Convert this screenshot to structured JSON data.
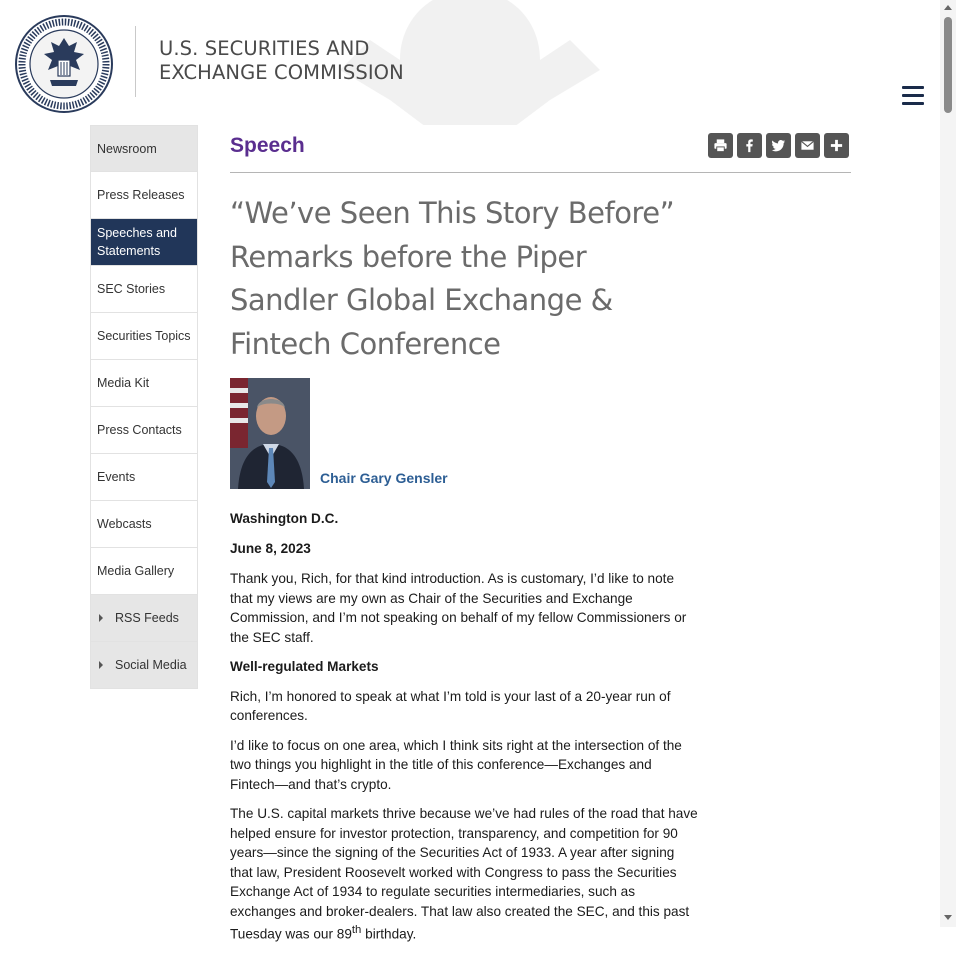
{
  "header": {
    "agency_line1": "U.S. SECURITIES AND",
    "agency_line2": "EXCHANGE COMMISSION",
    "seal_text": "U.S. SECURITIES AND EXCHANGE COMMISSION · MCMXXXIV",
    "menu_icon": "hamburger-icon"
  },
  "nav": {
    "items": [
      {
        "label": "Newsroom"
      },
      {
        "label": "Press Releases"
      },
      {
        "label": "Speeches and Statements"
      },
      {
        "label": "SEC Stories"
      },
      {
        "label": "Securities Topics"
      },
      {
        "label": "Media Kit"
      },
      {
        "label": "Press Contacts"
      },
      {
        "label": "Events"
      },
      {
        "label": "Webcasts"
      },
      {
        "label": "Media Gallery"
      },
      {
        "label": "RSS Feeds"
      },
      {
        "label": "Social Media"
      }
    ]
  },
  "main": {
    "section_title": "Speech",
    "share_icons": [
      "print-icon",
      "facebook-icon",
      "twitter-icon",
      "email-icon",
      "plus-icon"
    ],
    "title": "“We’ve Seen This Story Before” Remarks before the Piper Sandler Global Exchange & Fintech Conference",
    "author": "Chair Gary Gensler",
    "location": "Washington D.C.",
    "date": "June 8, 2023",
    "para1": "Thank you, Rich, for that kind introduction. As is customary, I’d like to note that my views are my own as Chair of the Securities and Exchange Commission, and I’m not speaking on behalf of my fellow Commissioners or the SEC staff.",
    "subhead": "Well-regulated Markets",
    "para2": "Rich, I’m honored to speak at what I’m told is your last of a 20-year run of conferences.",
    "para3": "I’d like to focus on one area, which I think sits right at the intersection of the two things you highlight in the title of this conference—Exchanges and Fintech—and that’s crypto.",
    "para4_main": "The U.S. capital markets thrive because we’ve had rules of the road that have helped ensure for investor protection, transparency, and competition for 90 years—since the signing of the Securities Act of 1933. A year after signing that law, President Roosevelt worked with Congress to pass the Securities Exchange Act of 1934 to regulate securities intermediaries, such as exchanges and broker-dealers. That law also created the SEC, and this past Tuesday was our 89",
    "para4_sup": "th",
    "para4_end": " birthday."
  },
  "colors": {
    "nav_active": "#213659",
    "section_title": "#5a2e8f",
    "author_link": "#2d5e94",
    "share_button": "#555555"
  }
}
